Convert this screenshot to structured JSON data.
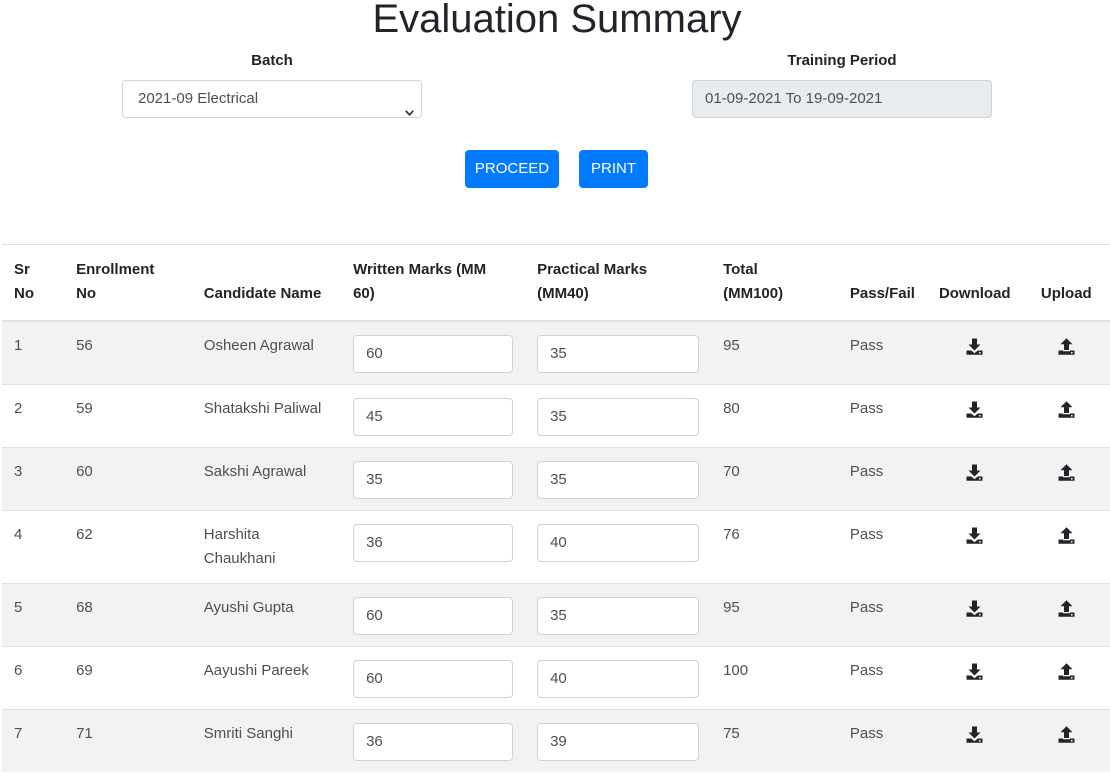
{
  "page": {
    "title": "Evaluation Summary"
  },
  "batch": {
    "label": "Batch",
    "selected": "2021-09 Electrical"
  },
  "training_period": {
    "label": "Training Period",
    "value": "01-09-2021 To 19-09-2021"
  },
  "actions": {
    "proceed_label": "PROCEED",
    "print_label": "PRINT"
  },
  "table": {
    "headers": {
      "sr_line1": "Sr",
      "sr_line2": "No",
      "enrollment_line1": "Enrollment",
      "enrollment_line2": "No",
      "name": "Candidate Name",
      "written_line1": "Written Marks (MM",
      "written_line2": "60)",
      "practical_line1": "Practical Marks",
      "practical_line2": "(MM40)",
      "total_line1": "Total",
      "total_line2": "(MM100)",
      "pass_fail": "Pass/Fail",
      "download": "Download",
      "upload": "Upload"
    },
    "rows": [
      {
        "sr": "1",
        "enrollment": "56",
        "name": "Osheen Agrawal",
        "written": "60",
        "practical": "35",
        "total": "95",
        "result": "Pass"
      },
      {
        "sr": "2",
        "enrollment": "59",
        "name": "Shatakshi Paliwal",
        "written": "45",
        "practical": "35",
        "total": "80",
        "result": "Pass"
      },
      {
        "sr": "3",
        "enrollment": "60",
        "name": "Sakshi Agrawal",
        "written": "35",
        "practical": "35",
        "total": "70",
        "result": "Pass"
      },
      {
        "sr": "4",
        "enrollment": "62",
        "name": "Harshita Chaukhani",
        "written": "36",
        "practical": "40",
        "total": "76",
        "result": "Pass"
      },
      {
        "sr": "5",
        "enrollment": "68",
        "name": "Ayushi Gupta",
        "written": "60",
        "practical": "35",
        "total": "95",
        "result": "Pass"
      },
      {
        "sr": "6",
        "enrollment": "69",
        "name": "Aayushi Pareek",
        "written": "60",
        "practical": "40",
        "total": "100",
        "result": "Pass"
      },
      {
        "sr": "7",
        "enrollment": "71",
        "name": "Smriti Sanghi",
        "written": "36",
        "practical": "39",
        "total": "75",
        "result": "Pass"
      }
    ]
  },
  "icons": {
    "download": "download-icon",
    "upload": "upload-icon",
    "select_arrow": "chevron-down-icon"
  },
  "colors": {
    "primary": "#007bff",
    "stripe": "#f2f2f2",
    "readonly_bg": "#e9ecef"
  }
}
